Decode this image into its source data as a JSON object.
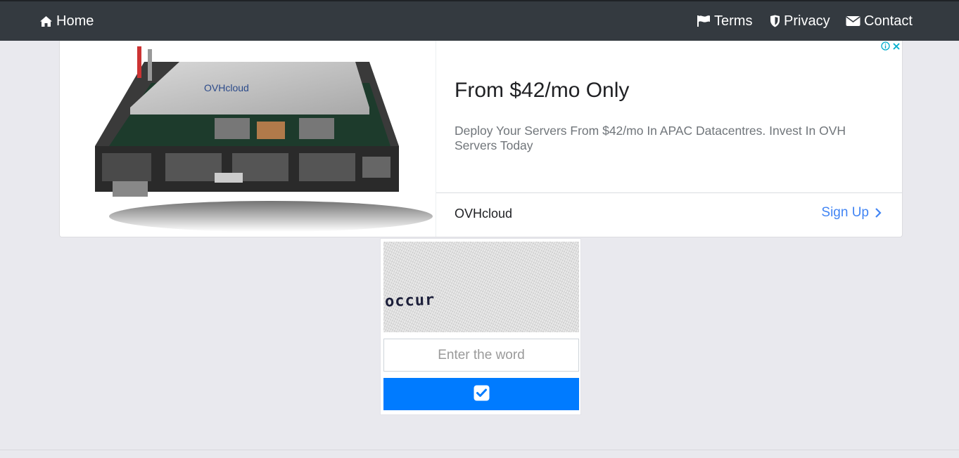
{
  "navbar": {
    "home": {
      "label": "Home",
      "icon": "home-icon"
    },
    "links": [
      {
        "label": "Terms",
        "icon": "flag-icon"
      },
      {
        "label": "Privacy",
        "icon": "shield-icon"
      },
      {
        "label": "Contact",
        "icon": "envelope-icon"
      }
    ]
  },
  "ad": {
    "headline": "From $42/mo Only",
    "description": "Deploy Your Servers From $42/mo In APAC Datacentres. Invest In OVH Servers Today",
    "advertiser": "OVHcloud",
    "cta": "Sign Up",
    "product_brand": "OVHcloud",
    "accent_color": "#4285f4"
  },
  "captcha": {
    "word": "occur",
    "input_placeholder": "Enter the word",
    "input_value": "",
    "submit_icon": "check-square-icon",
    "button_color": "#007bff"
  },
  "colors": {
    "navbar_bg": "#343a40",
    "page_bg": "#e9e9ee"
  }
}
